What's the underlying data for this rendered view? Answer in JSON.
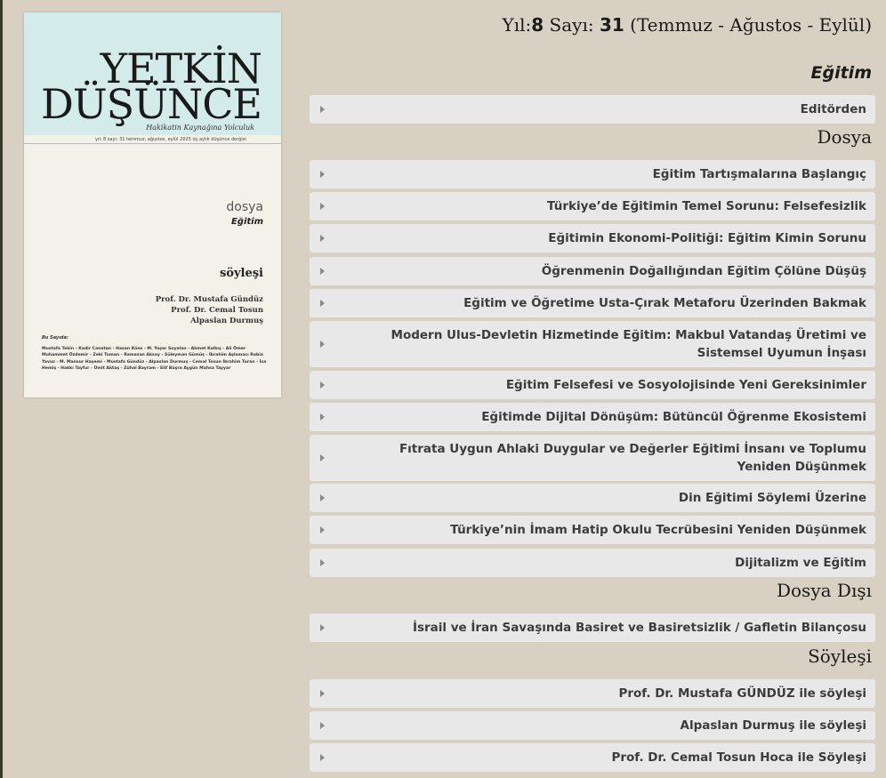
{
  "cover": {
    "title_line1": "YETKİN",
    "title_line2": "DÜŞÜNCE",
    "tagline": "Hakikatin Kaynağına Yolculuk",
    "meta": "yıl: 8   sayı: 31   temmuz, ağustos, eylül 2025   üç aylık düşünce dergisi",
    "dosya_label": "dosya",
    "dosya_topic": "Eğitim",
    "soylesi_label": "söyleşi",
    "persons": [
      "Prof. Dr. Mustafa Gündüz",
      "Prof. Dr. Cemal Tosun",
      "Alpaslan Durmuş"
    ],
    "authors_label": "Bu Sayıda:",
    "authors": "Mustafa Tekin - Kadir Canatan - Hasan Köse - M. Yaşar Soyalan - Ahmet Kalkış - Ali Ömer Muhammet Özdemir - Zeki Tuman - Ramazan Aksoy - Süleyman Gümüş - İbrahim Aşlamacı Rabia Yavuz - M. Mansur Haşemi - Mustafa Gündüz - Alpaslan Durmuş - Cemal Tosun İbrahim Turan - İsa Hemiş - Hakkı Tayfur - Ümit Aktaş - Zühal Bayram - Elif Büşra Aygün Mahsa Tayyar"
  },
  "issue": {
    "year_label": "Yıl:",
    "year": "8",
    "number_label": "Sayı:",
    "number": "31",
    "period": "(Temmuz - Ağustos - Eylül)"
  },
  "sections": {
    "main": "Eğitim",
    "editorial": "Editörden",
    "dosya": "Dosya",
    "dosya_disi": "Dosya Dışı",
    "soylesi": "Söyleşi"
  },
  "dosya_items": [
    "Eğitim Tartışmalarına Başlangıç",
    "Türkiye’de Eğitimin Temel Sorunu: Felsefesizlik",
    "Eğitimin Ekonomi-Politiği: Eğitim Kimin Sorunu",
    "Öğrenmenin Doğallığından Eğitim Çölüne Düşüş",
    "Eğitim ve Öğretime Usta-Çırak Metaforu Üzerinden Bakmak",
    "Modern Ulus-Devletin Hizmetinde Eğitim: Makbul Vatandaş Üretimi ve Sistemsel Uyumun İnşası",
    "Eğitim Felsefesi ve Sosyolojisinde Yeni Gereksinimler",
    "Eğitimde Dijital Dönüşüm: Bütüncül Öğrenme Ekosistemi",
    "Fıtrata Uygun Ahlaki Duygular ve Değerler Eğitimi İnsanı ve Toplumu Yeniden Düşünmek",
    "Din Eğitimi Söylemi Üzerine",
    "Türkiye’nin İmam Hatip Okulu Tecrübesini Yeniden Düşünmek",
    "Dijitalizm ve Eğitim"
  ],
  "dosya_disi_items": [
    "İsrail ve İran Savaşında Basiret ve Basiretsizlik / Gafletin Bilançosu"
  ],
  "soylesi_items": [
    "Prof. Dr. Mustafa GÜNDÜZ ile söyleşi",
    "Alpaslan Durmuş ile söyleşi",
    "Prof. Dr. Cemal Tosun Hoca ile Söyleşi"
  ]
}
